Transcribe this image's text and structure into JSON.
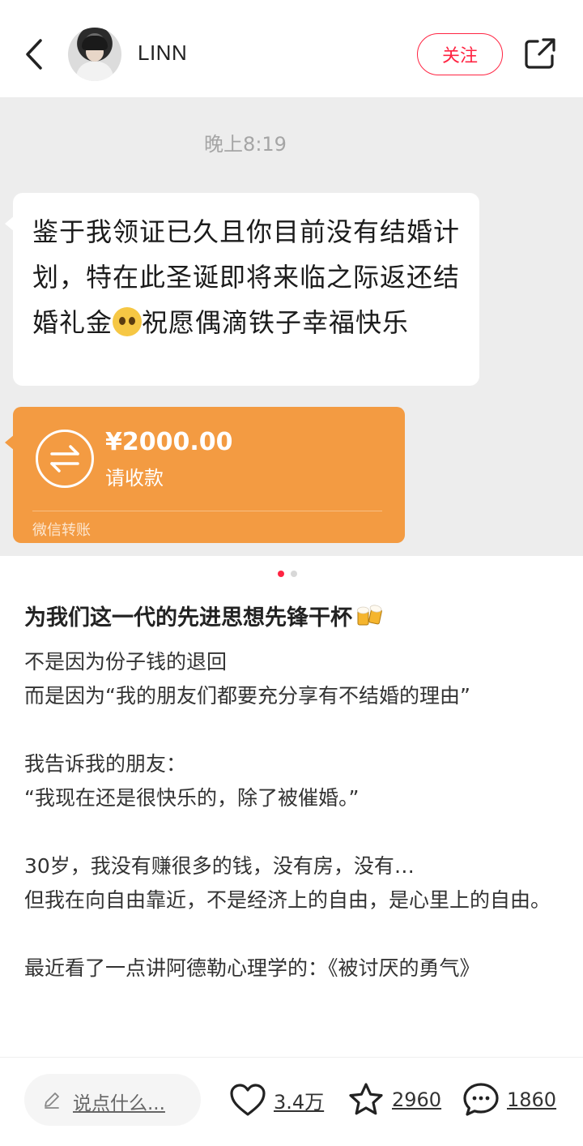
{
  "header": {
    "username": "LINN",
    "follow_label": "关注"
  },
  "image": {
    "timestamp": "晚上8:19",
    "message_part1": "鉴于我领证已久且你目前没有结婚计划，特在此圣诞即将来临之际返还结婚礼金",
    "message_part2": "祝愿偶滴铁子幸福快乐",
    "transfer_amount": "¥2000.00",
    "transfer_status": "请收款",
    "transfer_source": "微信转账",
    "transfer_color": "#f39b42"
  },
  "carousel": {
    "current_page": 1,
    "total_pages": 2
  },
  "post": {
    "title": "为我们这一代的先进思想先锋干杯",
    "paragraphs": [
      [
        "不是因为份子钱的退回",
        "而是因为“我的朋友们都要充分享有不结婚的理由”"
      ],
      [
        "我告诉我的朋友：",
        "“我现在还是很快乐的，除了被催婚。”"
      ],
      [
        "30岁，我没有赚很多的钱，没有房，没有…",
        "但我在向自由靠近，不是经济上的自由，是心里上的自由。"
      ],
      [
        "最近看了一点讲阿德勒心理学的：《被讨厌的勇气》"
      ]
    ]
  },
  "bottom_bar": {
    "comment_placeholder": "说点什么...",
    "likes": "3.4万",
    "collects": "2960",
    "comments": "1860"
  },
  "colors": {
    "accent": "#ff2442",
    "chat_bg": "#ededed"
  }
}
